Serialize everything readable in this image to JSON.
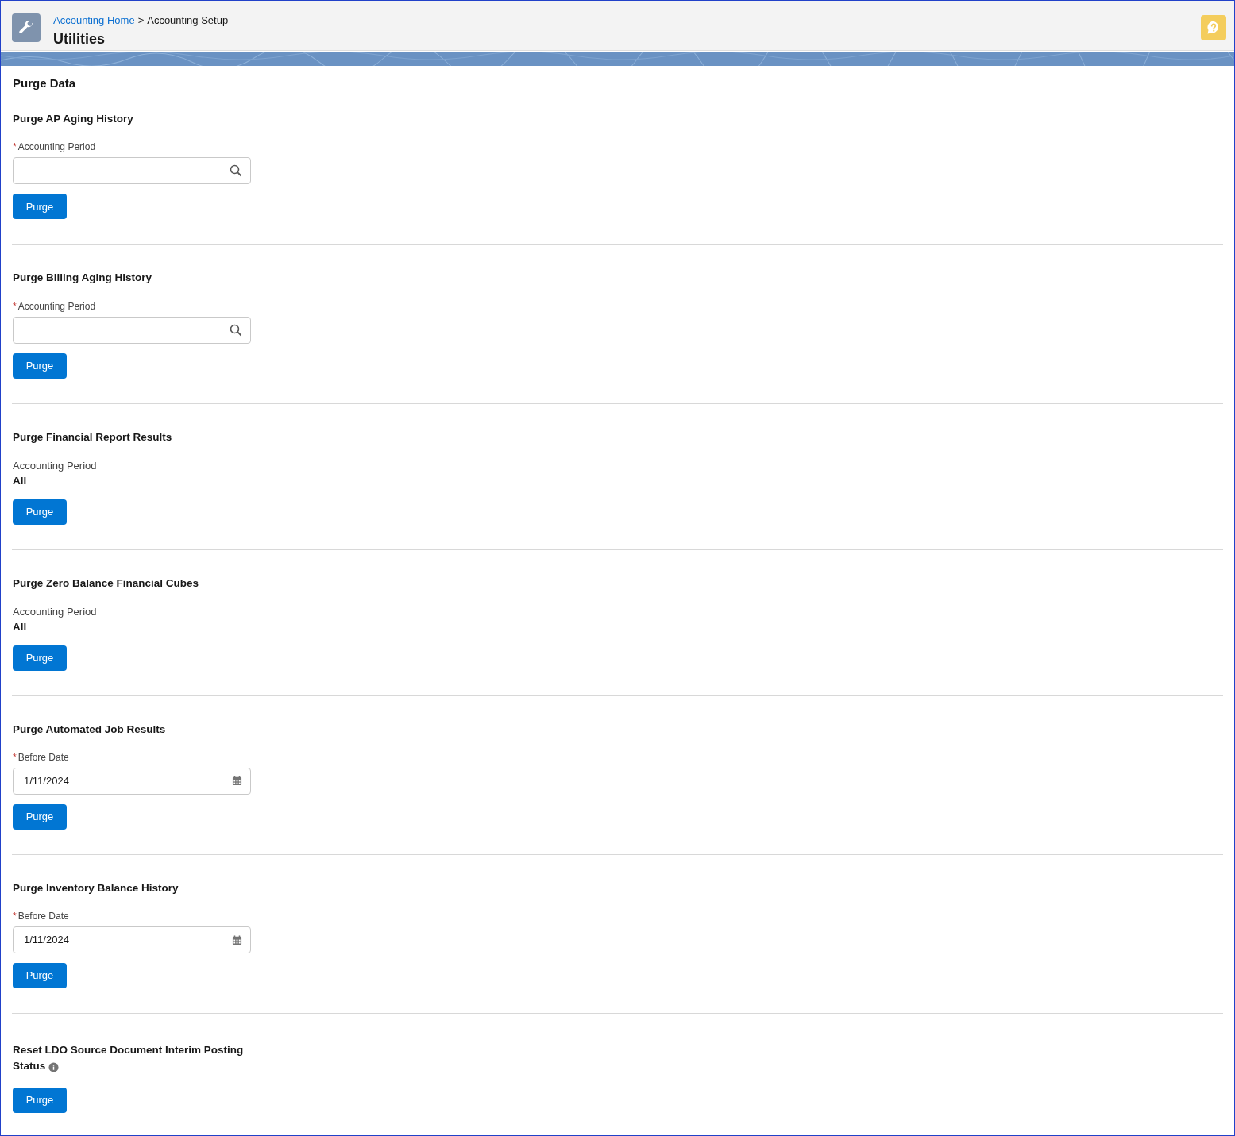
{
  "header": {
    "breadcrumbs": [
      {
        "label": "Accounting Home",
        "link": true
      },
      {
        "label": "Accounting Setup",
        "link": false
      }
    ],
    "separator": ">",
    "title": "Utilities"
  },
  "page_title": "Purge Data",
  "sections": [
    {
      "title": "Purge AP Aging History",
      "kind": "lookup",
      "field": {
        "label": "Accounting Period",
        "required_mark": "*"
      },
      "button": "Purge"
    },
    {
      "title": "Purge Billing Aging History",
      "kind": "lookup",
      "field": {
        "label": "Accounting Period",
        "required_mark": "*"
      },
      "button": "Purge"
    },
    {
      "title": "Purge Financial Report Results",
      "kind": "readonly",
      "field": {
        "label": "Accounting Period",
        "value": "All"
      },
      "button": "Purge"
    },
    {
      "title": "Purge Zero Balance Financial Cubes",
      "kind": "readonly",
      "field": {
        "label": "Accounting Period",
        "value": "All"
      },
      "button": "Purge"
    },
    {
      "title": "Purge Automated Job Results",
      "kind": "date",
      "field": {
        "label": "Before Date",
        "required_mark": "*",
        "value": "1/11/2024"
      },
      "button": "Purge"
    },
    {
      "title": "Purge Inventory Balance History",
      "kind": "date",
      "field": {
        "label": "Before Date",
        "required_mark": "*",
        "value": "1/11/2024"
      },
      "button": "Purge"
    },
    {
      "title": "Reset LDO Source Document Interim Posting Status",
      "info": true,
      "kind": "none",
      "button": "Purge"
    }
  ]
}
